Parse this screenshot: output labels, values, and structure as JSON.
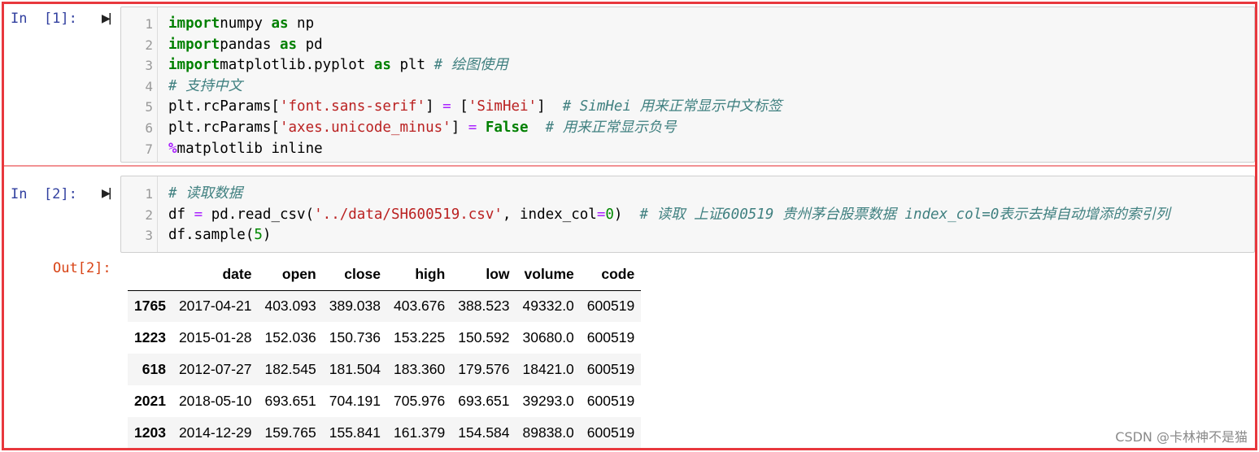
{
  "cells": [
    {
      "prompt": "In  [1]:",
      "lines": [
        {
          "num": "1",
          "tokens": [
            [
              "kw",
              "import"
            ],
            [
              "",
              "numpy "
            ],
            [
              "kw",
              "as"
            ],
            [
              "",
              " np"
            ]
          ]
        },
        {
          "num": "2",
          "tokens": [
            [
              "kw",
              "import"
            ],
            [
              "",
              "pandas "
            ],
            [
              "kw",
              "as"
            ],
            [
              "",
              " pd"
            ]
          ]
        },
        {
          "num": "3",
          "tokens": [
            [
              "kw",
              "import"
            ],
            [
              "",
              "matplotlib.pyplot "
            ],
            [
              "kw",
              "as"
            ],
            [
              "",
              " plt "
            ],
            [
              "cm",
              "# 绘图使用"
            ]
          ]
        },
        {
          "num": "4",
          "tokens": [
            [
              "cm",
              "# 支持中文"
            ]
          ]
        },
        {
          "num": "5",
          "tokens": [
            [
              "",
              "plt.rcParams["
            ],
            [
              "str",
              "'font.sans-serif'"
            ],
            [
              "",
              "] "
            ],
            [
              "op",
              "="
            ],
            [
              "",
              " ["
            ],
            [
              "str",
              "'SimHei'"
            ],
            [
              "",
              "]  "
            ],
            [
              "cm",
              "# SimHei 用来正常显示中文标签"
            ]
          ]
        },
        {
          "num": "6",
          "tokens": [
            [
              "",
              "plt.rcParams["
            ],
            [
              "str",
              "'axes.unicode_minus'"
            ],
            [
              "",
              "] "
            ],
            [
              "op",
              "="
            ],
            [
              "",
              " "
            ],
            [
              "kw",
              "False"
            ],
            [
              "",
              "  "
            ],
            [
              "cm",
              "# 用来正常显示负号"
            ]
          ]
        },
        {
          "num": "7",
          "tokens": [
            [
              "mg",
              "%"
            ],
            [
              "",
              "matplotlib inline"
            ]
          ]
        }
      ]
    },
    {
      "prompt": "In  [2]:",
      "lines": [
        {
          "num": "1",
          "tokens": [
            [
              "cm",
              "# 读取数据"
            ]
          ]
        },
        {
          "num": "2",
          "tokens": [
            [
              "",
              "df "
            ],
            [
              "op",
              "="
            ],
            [
              "",
              " pd.read_csv("
            ],
            [
              "str",
              "'../data/SH600519.csv'"
            ],
            [
              "",
              ", index_col"
            ],
            [
              "op",
              "="
            ],
            [
              "num",
              "0"
            ],
            [
              "",
              ")  "
            ],
            [
              "cm",
              "# 读取 上证600519 贵州茅台股票数据 index_col=0表示去掉自动增添的索引列"
            ]
          ]
        },
        {
          "num": "3",
          "tokens": [
            [
              "",
              "df.sample("
            ],
            [
              "num",
              "5"
            ],
            [
              "",
              ")"
            ]
          ]
        }
      ],
      "out_prompt": "Out[2]:",
      "table": {
        "columns": [
          "date",
          "open",
          "close",
          "high",
          "low",
          "volume",
          "code"
        ],
        "rows": [
          {
            "index": "1765",
            "cells": [
              "2017-04-21",
              "403.093",
              "389.038",
              "403.676",
              "388.523",
              "49332.0",
              "600519"
            ]
          },
          {
            "index": "1223",
            "cells": [
              "2015-01-28",
              "152.036",
              "150.736",
              "153.225",
              "150.592",
              "30680.0",
              "600519"
            ]
          },
          {
            "index": "618",
            "cells": [
              "2012-07-27",
              "182.545",
              "181.504",
              "183.360",
              "179.576",
              "18421.0",
              "600519"
            ]
          },
          {
            "index": "2021",
            "cells": [
              "2018-05-10",
              "693.651",
              "704.191",
              "705.976",
              "693.651",
              "39293.0",
              "600519"
            ]
          },
          {
            "index": "1203",
            "cells": [
              "2014-12-29",
              "159.765",
              "155.841",
              "161.379",
              "154.584",
              "89838.0",
              "600519"
            ]
          }
        ]
      }
    }
  ],
  "run_icon": "run-cell-icon",
  "watermark": "CSDN @卡林神不是猫"
}
